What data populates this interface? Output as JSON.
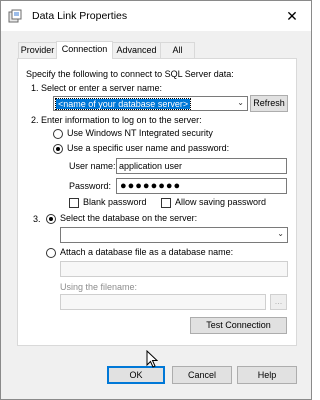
{
  "window": {
    "title": "Data Link Properties",
    "close_glyph": "✕",
    "icon": "datalink-app-icon"
  },
  "tabs": [
    {
      "label": "Provider",
      "active": false
    },
    {
      "label": "Connection",
      "active": true
    },
    {
      "label": "Advanced",
      "active": false
    },
    {
      "label": "All",
      "active": false
    }
  ],
  "connection": {
    "intro": "Specify the following to connect to SQL Server data:",
    "step1_label": "1. Select or enter a server name:",
    "server_value": "<name of your database server>",
    "refresh_label": "Refresh",
    "step2_label": "2. Enter information to log on to the server:",
    "nt_security_label": "Use Windows NT Integrated security",
    "specific_user_label": "Use a specific user name and password:",
    "username_label": "User name:",
    "username_value": "application user",
    "password_label": "Password:",
    "password_value": "●●●●●●●●",
    "blank_password_label": "Blank password",
    "allow_saving_label": "Allow saving password",
    "step3_number": "3.",
    "select_db_label": "Select the database on the server:",
    "database_value": "",
    "attach_db_label": "Attach a database file as a database name:",
    "attach_name_value": "",
    "filename_label": "Using the filename:",
    "filename_value": "",
    "browse_label": "...",
    "test_connection_label": "Test Connection"
  },
  "footer": {
    "ok_label": "OK",
    "cancel_label": "Cancel",
    "help_label": "Help"
  },
  "colors": {
    "accent": "#0078d7",
    "window_bg": "#f0f0f0"
  }
}
